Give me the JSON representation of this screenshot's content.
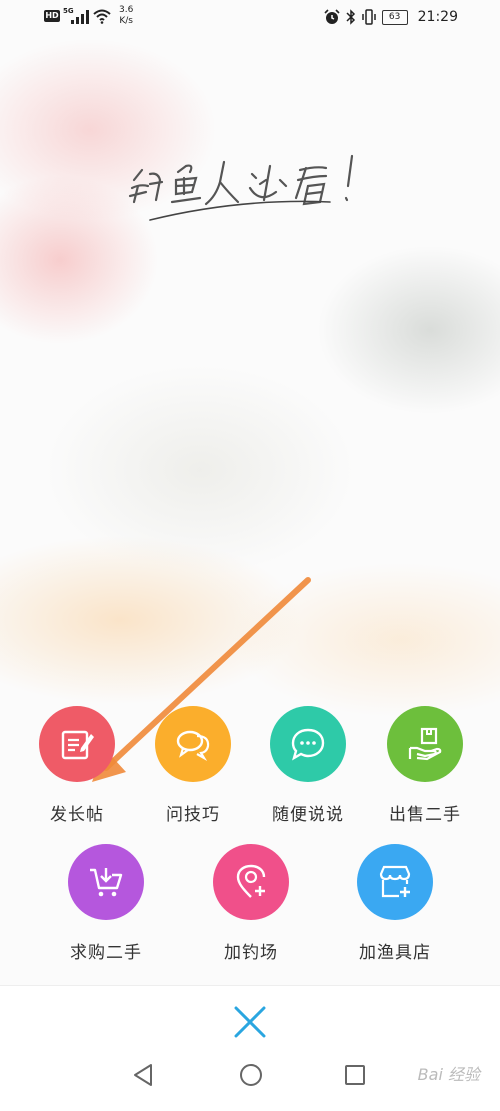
{
  "status_bar": {
    "network_badge": "HD",
    "network_type": "5G",
    "speed": "3.6\nK/s",
    "battery": "63",
    "time": "21:29"
  },
  "banner": {
    "handwritten_text": "钓鱼人必看!"
  },
  "actions": [
    {
      "label": "发长帖",
      "icon": "edit-note-icon",
      "color": "#ef5b67"
    },
    {
      "label": "问技巧",
      "icon": "chat-bubbles-icon",
      "color": "#fbae2c"
    },
    {
      "label": "随便说说",
      "icon": "speech-bubble-icon",
      "color": "#2ecaa8"
    },
    {
      "label": "出售二手",
      "icon": "hand-box-icon",
      "color": "#6dbf3c"
    },
    {
      "label": "求购二手",
      "icon": "shopping-cart-icon",
      "color": "#b557dd"
    },
    {
      "label": "加钓场",
      "icon": "location-add-icon",
      "color": "#f0508a"
    },
    {
      "label": "加渔具店",
      "icon": "store-add-icon",
      "color": "#3aa8f2"
    }
  ],
  "close_button": {
    "icon": "close-icon",
    "color": "#2aa6e0"
  },
  "nav_bar": {
    "back": "back-icon",
    "home": "home-icon",
    "recent": "recent-apps-icon"
  },
  "watermark": "Bai 经验"
}
